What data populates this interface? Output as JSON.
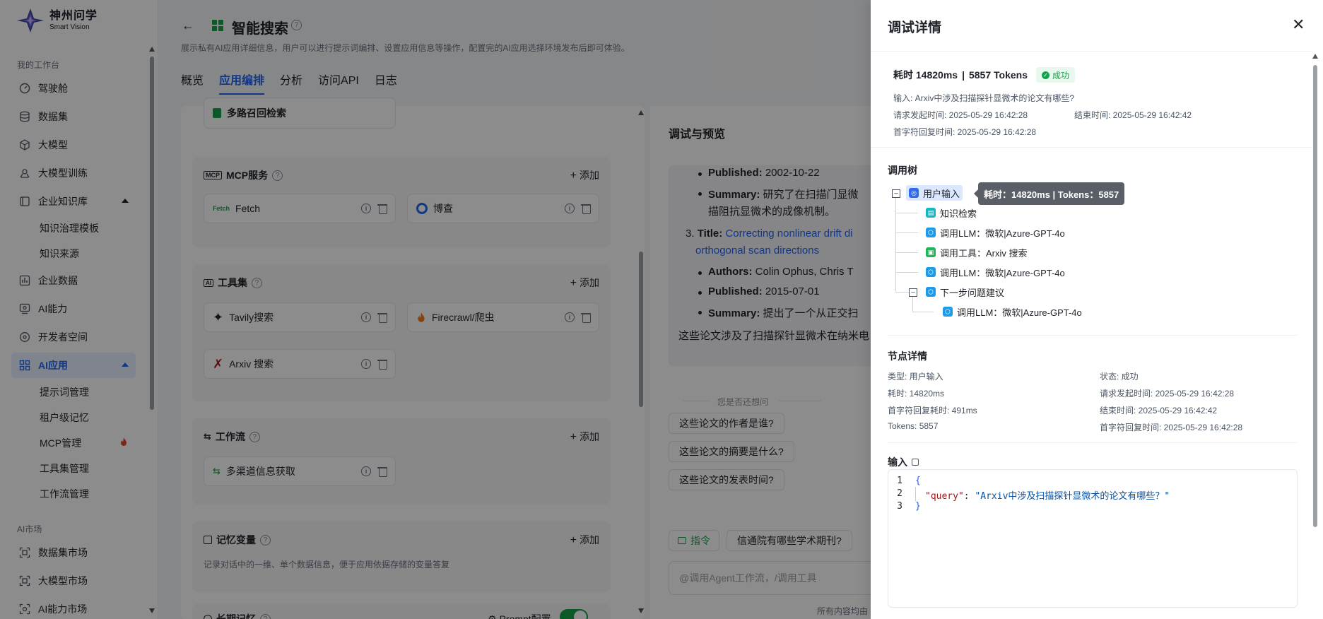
{
  "brand": {
    "name_cn": "神州问学",
    "name_en": "Smart Vision"
  },
  "sidebar": {
    "section_workspace": "我的工作台",
    "items": [
      {
        "label": "驾驶舱",
        "icon": "dashboard-icon"
      },
      {
        "label": "数据集",
        "icon": "database-icon"
      },
      {
        "label": "大模型",
        "icon": "cube-icon"
      },
      {
        "label": "大模型训练",
        "icon": "train-icon"
      },
      {
        "label": "企业知识库",
        "icon": "book-icon"
      },
      {
        "label": "企业数据",
        "icon": "chart-icon"
      },
      {
        "label": "AI能力",
        "icon": "ai-icon"
      },
      {
        "label": "开发者空间",
        "icon": "dev-icon"
      },
      {
        "label": "AI应用",
        "icon": "apps-icon"
      }
    ],
    "knowledge_sub": [
      "知识治理模板",
      "知识来源"
    ],
    "ai_app_sub": [
      "提示词管理",
      "租户级记忆",
      "MCP管理",
      "工具集管理",
      "工作流管理"
    ],
    "section_market": "AI市场",
    "market_items": [
      "数据集市场",
      "大模型市场",
      "AI能力市场"
    ]
  },
  "header": {
    "back": "←",
    "title": "智能搜索",
    "desc": "展示私有AI应用详细信息，用户可以进行提示词编排、设置应用信息等操作，配置完的AI应用选择环境发布后即可体验。",
    "tabs": [
      "概览",
      "应用编排",
      "分析",
      "访问API",
      "日志"
    ],
    "active_tab": "应用编排"
  },
  "config": {
    "knowledge_card": "多路召回检索",
    "add_label": "添加",
    "mcp": {
      "title": "MCP服务",
      "items": [
        "Fetch",
        "博查"
      ]
    },
    "tools": {
      "title": "工具集",
      "items": [
        "Tavily搜索",
        "Firecrawl/爬虫",
        "Arxiv 搜索"
      ]
    },
    "workflow": {
      "title": "工作流",
      "items": [
        "多渠道信息获取"
      ]
    },
    "memory": {
      "title": "记忆变量",
      "desc": "记录对话中的一维、单个数据信息，便于应用依据存储的变量答复"
    },
    "long_memory": {
      "title": "长期记忆",
      "prompt_cfg": "Prompt配置"
    }
  },
  "preview": {
    "title": "调试与预览",
    "lines": {
      "published1_label": "Published:",
      "published1": "2002-10-22",
      "summary1_label": "Summary:",
      "summary1": "研究了在扫描门显微",
      "summary1b": "描阻抗显微术的成像机制。",
      "item3_num": "3.",
      "item3_title_label": "Title:",
      "item3_title": "Correcting nonlinear drift di",
      "item3_title_b": "orthogonal scan directions",
      "authors_label": "Authors:",
      "authors": "Colin Ophus, Chris T",
      "published2_label": "Published:",
      "published2": "2015-07-01",
      "summary2_label": "Summary:",
      "summary2": "提出了一个从正交扫",
      "conclusion": "这些论文涉及了扫描探针显微术在纳米电"
    },
    "suggest_header": "您是否还想问",
    "suggestions": [
      "这些论文的作者是谁?",
      "这些论文的摘要是什么?",
      "这些论文的发表时间?"
    ],
    "cmd_label": "指令",
    "quick_question": "信通院有哪些学术期刊?",
    "input_placeholder": "@调用Agent工作流，/调用工具",
    "footnote": "所有内容均由"
  },
  "drawer": {
    "title": "调试详情",
    "close": "✕",
    "summary": {
      "time": "耗时  14820ms",
      "sep": "|",
      "tokens": "5857 Tokens",
      "status": "成功"
    },
    "input_text": "输入: Arxiv中涉及扫描探针显微术的论文有哪些?",
    "req_time": "请求发起时间:  2025-05-29 16:42:28",
    "end_time": "结束时间:  2025-05-29 16:42:42",
    "first_token_time": "首字符回复时间:  2025-05-29 16:42:28",
    "tree_title": "调用树",
    "tree": [
      {
        "label": "用户输入",
        "color": "#2f6bf0"
      },
      {
        "label": "知识检索",
        "color": "#14b8c4"
      },
      {
        "label": "调用LLM：微软|Azure-GPT-4o",
        "color": "#1e9be8"
      },
      {
        "label": "调用工具：Arxiv 搜索",
        "color": "#22b55c"
      },
      {
        "label": "调用LLM：微软|Azure-GPT-4o",
        "color": "#1e9be8"
      },
      {
        "label": "下一步问题建议",
        "color": "#1e9be8"
      },
      {
        "label": "调用LLM：微软|Azure-GPT-4o",
        "color": "#1e9be8"
      }
    ],
    "tooltip": "耗时：14820ms | Tokens：5857",
    "node_title": "节点详情",
    "node": {
      "type": "类型: 用户输入",
      "status": "状态: 成功",
      "cost": "耗时: 14820ms",
      "req": "请求发起时间:  2025-05-29 16:42:28",
      "first_reply": "首字符回复耗时: 491ms",
      "end": "结束时间:  2025-05-29 16:42:42",
      "tokens": "Tokens: 5857",
      "first_time": "首字符回复时间:  2025-05-29 16:42:28"
    },
    "input_title": "输入",
    "code": {
      "l1": "{",
      "key": "\"query\"",
      "colon": ": ",
      "value": "\"Arxiv中涉及扫描探针显微术的论文有哪些？\"",
      "l3": "}"
    }
  }
}
